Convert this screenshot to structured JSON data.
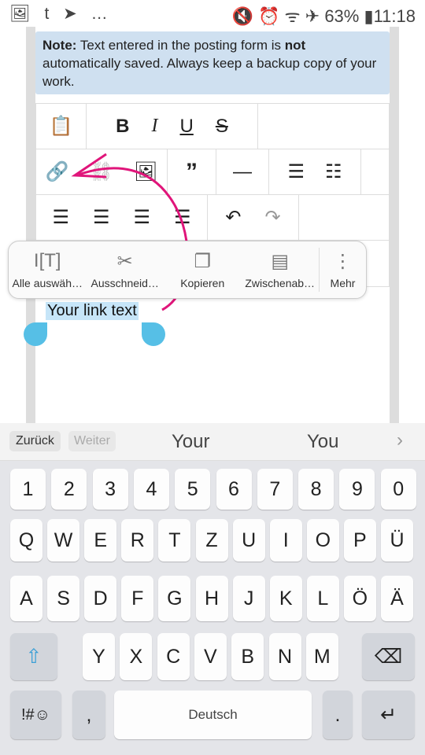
{
  "status": {
    "left_icons": "gallery-icon t telegram-icon …",
    "left_text": "🖼 t ➤ …",
    "right_icons": [
      "mute-icon",
      "alarm-icon",
      "wifi-icon",
      "airplane-icon"
    ],
    "battery": "63%",
    "time": "11:18"
  },
  "note": {
    "label": "Note:",
    "text1": " Text entered in the posting form is ",
    "bold": "not",
    "text2": " automatically saved. Always keep a backup copy of your work."
  },
  "toolbar": {
    "icons": [
      "paste",
      "bold",
      "italic",
      "underline",
      "strikethrough",
      "link",
      "unlink",
      "image",
      "quote",
      "horizontal-rule",
      "bulleted-list",
      "numbered-list",
      "align-left",
      "align-center",
      "align-right",
      "justify",
      "undo",
      "redo"
    ]
  },
  "context_menu": {
    "items": [
      {
        "label": "Alle auswäh…",
        "icon": "select-all-icon"
      },
      {
        "label": "Ausschneid…",
        "icon": "scissors-icon"
      },
      {
        "label": "Kopieren",
        "icon": "copy-icon"
      },
      {
        "label": "Zwischenab…",
        "icon": "clipboard-icon"
      },
      {
        "label": "Mehr",
        "icon": "more-icon"
      }
    ]
  },
  "editor": {
    "selected_text": "Your link text"
  },
  "annotation_color": "#e0157a",
  "keyboard": {
    "back": "Zurück",
    "forward": "Weiter",
    "suggestions": [
      "Your",
      "You"
    ],
    "rows": [
      [
        "1",
        "2",
        "3",
        "4",
        "5",
        "6",
        "7",
        "8",
        "9",
        "0"
      ],
      [
        "Q",
        "W",
        "E",
        "R",
        "T",
        "Z",
        "U",
        "I",
        "O",
        "P",
        "Ü"
      ],
      [
        "A",
        "S",
        "D",
        "F",
        "G",
        "H",
        "J",
        "K",
        "L",
        "Ö",
        "Ä"
      ],
      [
        "Y",
        "X",
        "C",
        "V",
        "B",
        "N",
        "M"
      ]
    ],
    "symbols": "!#☺",
    "comma": ",",
    "space": "Deutsch",
    "period": "."
  }
}
